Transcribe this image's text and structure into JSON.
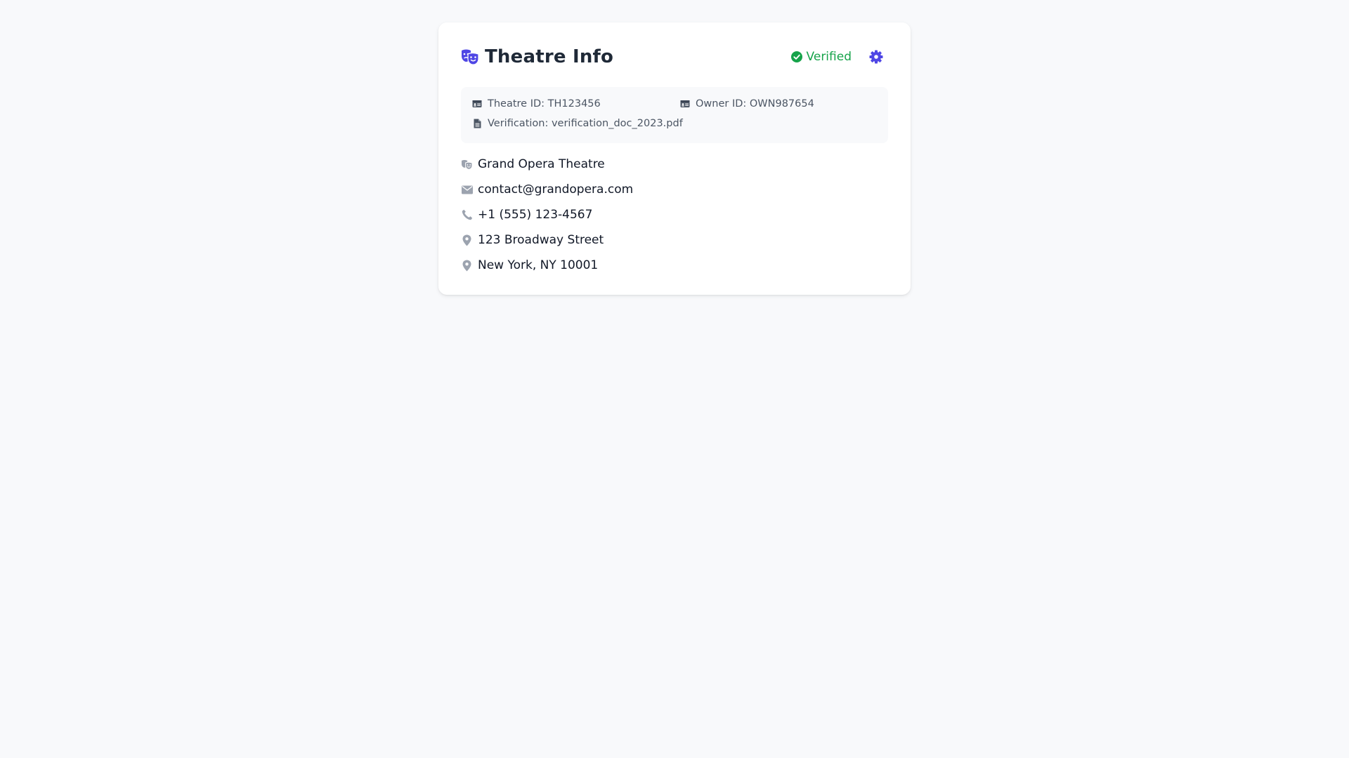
{
  "colors": {
    "accent": "#4f46e5",
    "success": "#16a34a",
    "icon_muted": "#9ca3af",
    "meta_icon": "#4b5563"
  },
  "header": {
    "icon": "theater-masks-icon",
    "title": "Theatre Info",
    "status": {
      "icon": "check-circle-icon",
      "label": "Verified"
    },
    "settings_icon": "gear-icon"
  },
  "meta": {
    "theatre_id": "Theatre ID: TH123456",
    "owner_id": "Owner ID: OWN987654",
    "verification": "Verification: verification_doc_2023.pdf"
  },
  "details": {
    "name": "Grand Opera Theatre",
    "email": "contact@grandopera.com",
    "phone": "+1 (555) 123-4567",
    "street": "123 Broadway Street",
    "city": "New York, NY 10001"
  }
}
